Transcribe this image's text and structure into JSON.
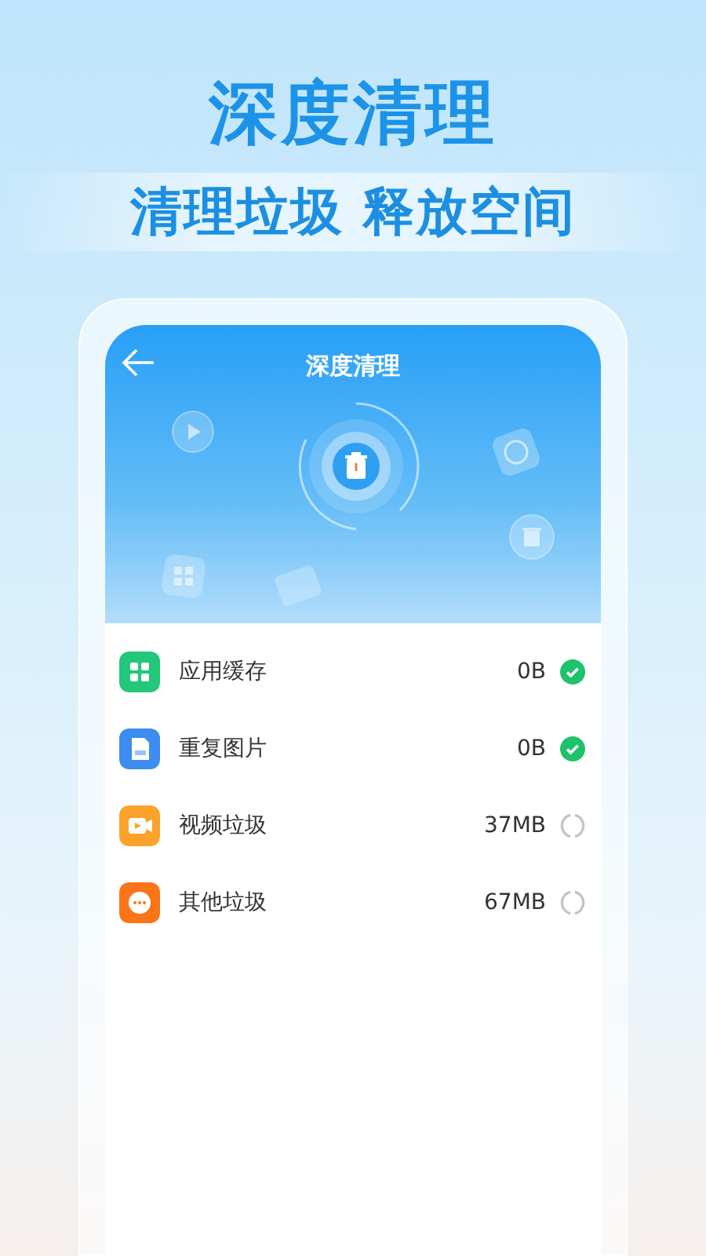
{
  "headline": "深度清理",
  "subtitle": "清理垃圾 释放空间",
  "screen": {
    "title": "深度清理",
    "items": [
      {
        "kind": "app",
        "name": "应用缓存",
        "size": "0B",
        "done": true,
        "color": "#22c77a"
      },
      {
        "kind": "image",
        "name": "重复图片",
        "size": "0B",
        "done": true,
        "color": "#3d8cf0"
      },
      {
        "kind": "video",
        "name": "视频垃圾",
        "size": "37MB",
        "done": false,
        "color": "#fba22c"
      },
      {
        "kind": "other",
        "name": "其他垃圾",
        "size": "67MB",
        "done": false,
        "color": "#fb7418"
      }
    ]
  }
}
